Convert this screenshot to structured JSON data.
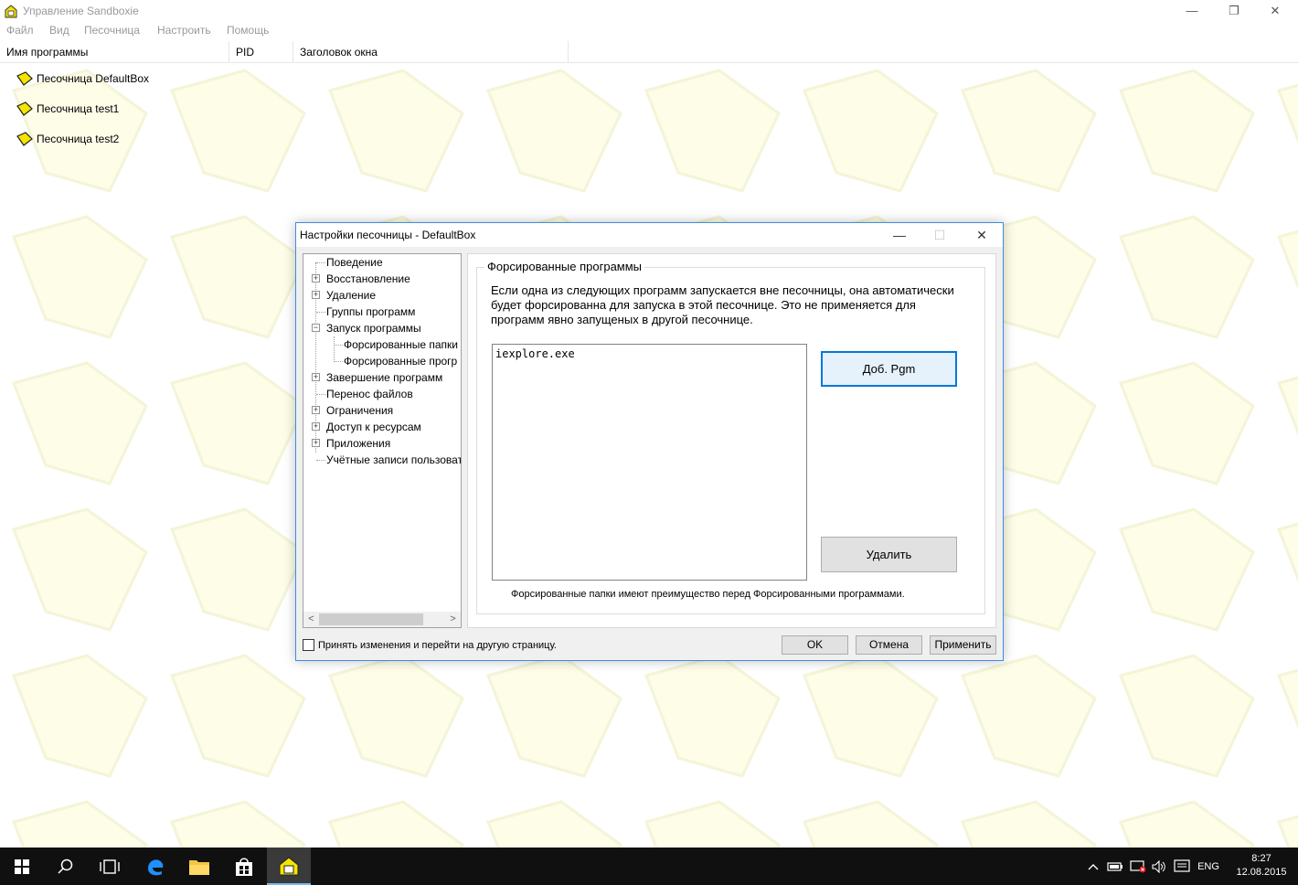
{
  "app": {
    "title": "Управление Sandboxie",
    "menu": [
      "Файл",
      "Вид",
      "Песочница",
      "Настроить",
      "Помощь"
    ],
    "columns": [
      "Имя программы",
      "PID",
      "Заголовок окна"
    ],
    "sandboxes": [
      "Песочница DefaultBox",
      "Песочница test1",
      "Песочница test2"
    ],
    "window_controls": {
      "minimize": "—",
      "restore": "❐",
      "close": "✕"
    }
  },
  "dialog": {
    "title": "Настройки песочницы - DefaultBox",
    "controls": {
      "minimize": "—",
      "maximize": "☐",
      "close": "✕"
    },
    "tree": [
      {
        "label": "Поведение",
        "expander": ""
      },
      {
        "label": "Восстановление",
        "expander": "+"
      },
      {
        "label": "Удаление",
        "expander": "+"
      },
      {
        "label": "Группы программ",
        "expander": ""
      },
      {
        "label": "Запуск программы",
        "expander": "−"
      },
      {
        "label": "Форсированные папки",
        "expander": ""
      },
      {
        "label": "Форсированные прогр",
        "expander": ""
      },
      {
        "label": "Завершение программ",
        "expander": "+"
      },
      {
        "label": "Перенос файлов",
        "expander": ""
      },
      {
        "label": "Ограничения",
        "expander": "+"
      },
      {
        "label": "Доступ к ресурсам",
        "expander": "+"
      },
      {
        "label": "Приложения",
        "expander": "+"
      },
      {
        "label": "Учётные записи пользоват",
        "expander": ""
      }
    ],
    "scroll": {
      "left": "<",
      "right": ">"
    },
    "group_title": "Форсированные программы",
    "description": "Если одна из следующих программ запускается вне песочницы, она автоматически будет форсированна для запуска в этой песочнице.  Это не применяется для программ явно запущеных в другой песочнице.",
    "programs": [
      "iexplore.exe"
    ],
    "add_button": "Доб. Pgm",
    "remove_button": "Удалить",
    "note": "Форсированные папки имеют преимущество перед Форсированными программами.",
    "checkbox_label": "Принять изменения и перейти на другую страницу.",
    "ok": "OK",
    "cancel": "Отмена",
    "apply": "Применить"
  },
  "taskbar": {
    "language": "ENG",
    "time": "8:27",
    "date": "12.08.2015"
  },
  "colors": {
    "accent": "#0078d7",
    "watermark_fill": "#fdfde8",
    "watermark_stroke": "#f4f4d8",
    "icon_yellow": "#f5e400"
  }
}
